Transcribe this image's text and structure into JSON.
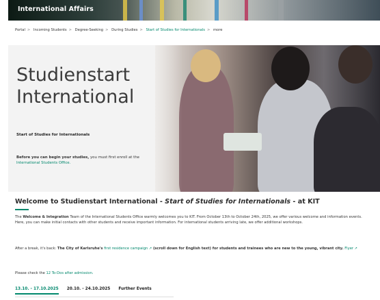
{
  "header": {
    "title": "International Affairs"
  },
  "breadcrumb": {
    "items": [
      "Portal",
      "Incoming Students",
      "Degree-Seeking",
      "During Studies"
    ],
    "current": "Start of Studies for Internationals",
    "more": "more"
  },
  "hero": {
    "title": "Studienstart International",
    "subtitle": "Start of Studies for Internationals",
    "note_bold": "Before you can begin your studies,",
    "note_text": " you must first enroll at the",
    "note_link": "International Students Office."
  },
  "welcome": {
    "title_a": "Welcome to Studienstart International - ",
    "title_b": "Start of Studies for Internationals",
    "title_c": " - at KIT"
  },
  "para1": {
    "pre": "The ",
    "bold": "Welcome & Integration",
    "text": " Team of the International Students Office warmly welcomes you to KIT. From October 13th to October 24th, 2025, we offer various welcome and information events. Here, you can make initial contacts with other students and receive important information. For international students arriving late, we offer additional workshops."
  },
  "para2": {
    "pre": "After a break, it's back: ",
    "bold": "The City of Karlsruhe's",
    "link": "first residence campaign",
    "bold2": "(scroll down for English text) for students and trainees who are new to the young, vibrant city.",
    "flyer": "Flyer"
  },
  "para3": {
    "pre": "Please check the ",
    "link": "12 To-Dos after admission."
  },
  "tabs": [
    "13.10. - 17.10.2025",
    "20.10. - 24.10.2025",
    "Further Events"
  ],
  "colors": {
    "accent": "#00876c"
  }
}
